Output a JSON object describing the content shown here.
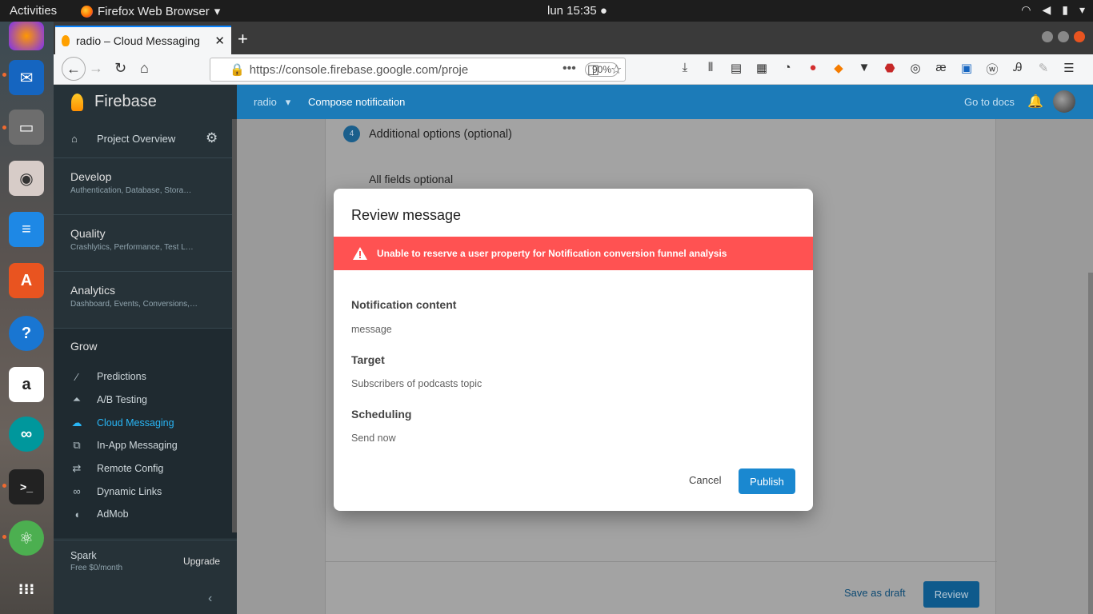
{
  "system": {
    "activities": "Activities",
    "app_name": "Firefox Web Browser",
    "clock": "lun 15:35 ●"
  },
  "browser": {
    "tab_title": "radio – Cloud Messaging",
    "url": "https://console.firebase.google.com/proje",
    "zoom": "90%"
  },
  "sidebar": {
    "brand": "Firebase",
    "project_overview": "Project Overview",
    "sections": [
      {
        "title": "Develop",
        "sub": "Authentication, Database, Stora…"
      },
      {
        "title": "Quality",
        "sub": "Crashlytics, Performance, Test L…"
      },
      {
        "title": "Analytics",
        "sub": "Dashboard, Events, Conversions,…"
      }
    ],
    "grow_title": "Grow",
    "grow_items": [
      "Predictions",
      "A/B Testing",
      "Cloud Messaging",
      "In-App Messaging",
      "Remote Config",
      "Dynamic Links",
      "AdMob"
    ],
    "plan": "Spark",
    "plan_price": "Free $0/month",
    "upgrade": "Upgrade"
  },
  "header": {
    "project": "radio",
    "crumb": "Compose notification",
    "docs": "Go to docs"
  },
  "page": {
    "step_number": "4",
    "step_title": "Additional options (optional)",
    "step_sub": "All fields optional",
    "save_draft": "Save as draft",
    "review": "Review"
  },
  "modal": {
    "title": "Review message",
    "error": "Unable to reserve a user property for Notification conversion funnel analysis",
    "content_label": "Notification content",
    "content_value": "message",
    "target_label": "Target",
    "target_value": "Subscribers of podcasts topic",
    "scheduling_label": "Scheduling",
    "scheduling_value": "Send now",
    "cancel": "Cancel",
    "publish": "Publish"
  },
  "colors": {
    "firebase_header": "#1c7bb8",
    "sidebar": "#263238",
    "error_banner": "#ff5252",
    "publish_button": "#1a88d0",
    "active_item": "#29b6f6"
  }
}
